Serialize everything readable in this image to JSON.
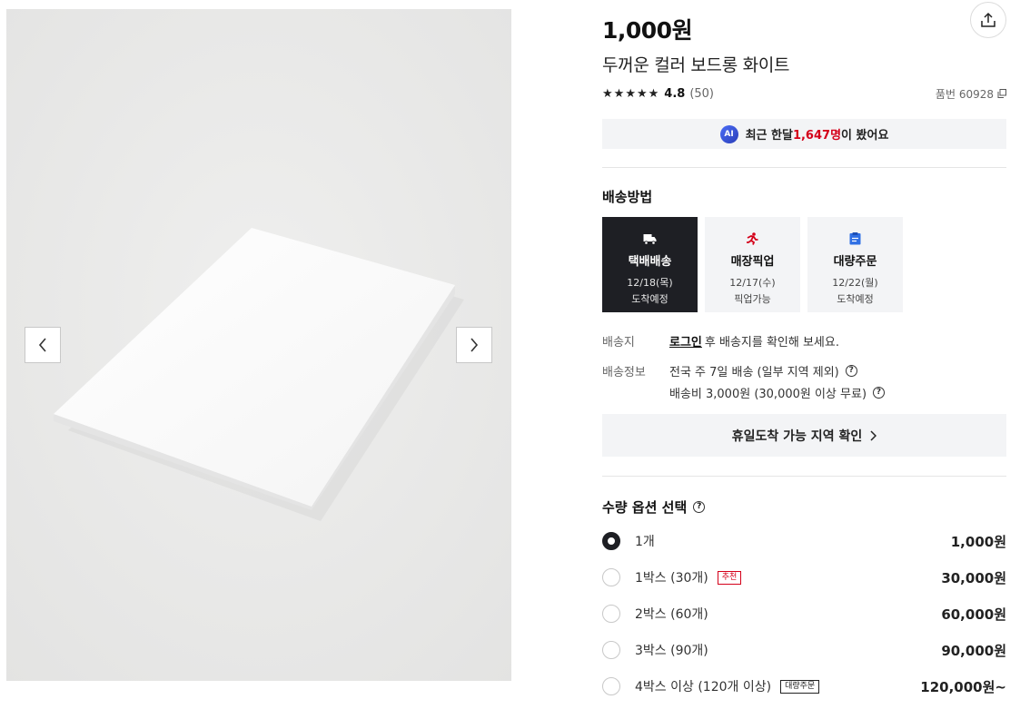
{
  "gallery": {
    "prev_label": "<",
    "next_label": ">"
  },
  "product": {
    "price": "1,000원",
    "name": "두꺼운 컬러 보드롱 화이트",
    "rating": "4.8",
    "rating_count": "(50)",
    "stars": 5,
    "part_number_label": "품번 60928"
  },
  "ai_bar": {
    "badge": "AI",
    "prefix": "최근 한달 ",
    "highlight": "1,647명",
    "suffix": "이 봤어요"
  },
  "shipping": {
    "title": "배송방법",
    "methods": [
      {
        "title": "택배배송",
        "date": "12/18(목)",
        "note": "도착예정",
        "active": true,
        "icon": "truck-icon"
      },
      {
        "title": "매장픽업",
        "date": "12/17(수)",
        "note": "픽업가능",
        "active": false,
        "icon": "runner-icon"
      },
      {
        "title": "대량주문",
        "date": "12/22(월)",
        "note": "도착예정",
        "active": false,
        "icon": "clipboard-icon"
      }
    ],
    "destination_label": "배송지",
    "login_link": "로그인",
    "destination_text": " 후 배송지를 확인해 보세요.",
    "info_label": "배송정보",
    "info_line1": "전국 주 7일 배송 (일부 지역 제외)",
    "info_line2": "배송비 3,000원 (30,000원 이상 무료)",
    "holiday_button": "휴일도착 가능 지역 확인"
  },
  "options": {
    "title": "수량 옵션 선택",
    "items": [
      {
        "label": "1개",
        "price": "1,000원",
        "selected": true,
        "badge": ""
      },
      {
        "label": "1박스 (30개)",
        "price": "30,000원",
        "selected": false,
        "badge": "추천"
      },
      {
        "label": "2박스 (60개)",
        "price": "60,000원",
        "selected": false,
        "badge": ""
      },
      {
        "label": "3박스 (90개)",
        "price": "90,000원",
        "selected": false,
        "badge": ""
      },
      {
        "label": "4박스 이상 (120개 이상)",
        "price": "120,000원~",
        "selected": false,
        "badge": "대량주문"
      }
    ]
  },
  "colors": {
    "accent_red": "#d4001a",
    "dark": "#1e1f24",
    "panel_bg": "#f3f4f6"
  }
}
